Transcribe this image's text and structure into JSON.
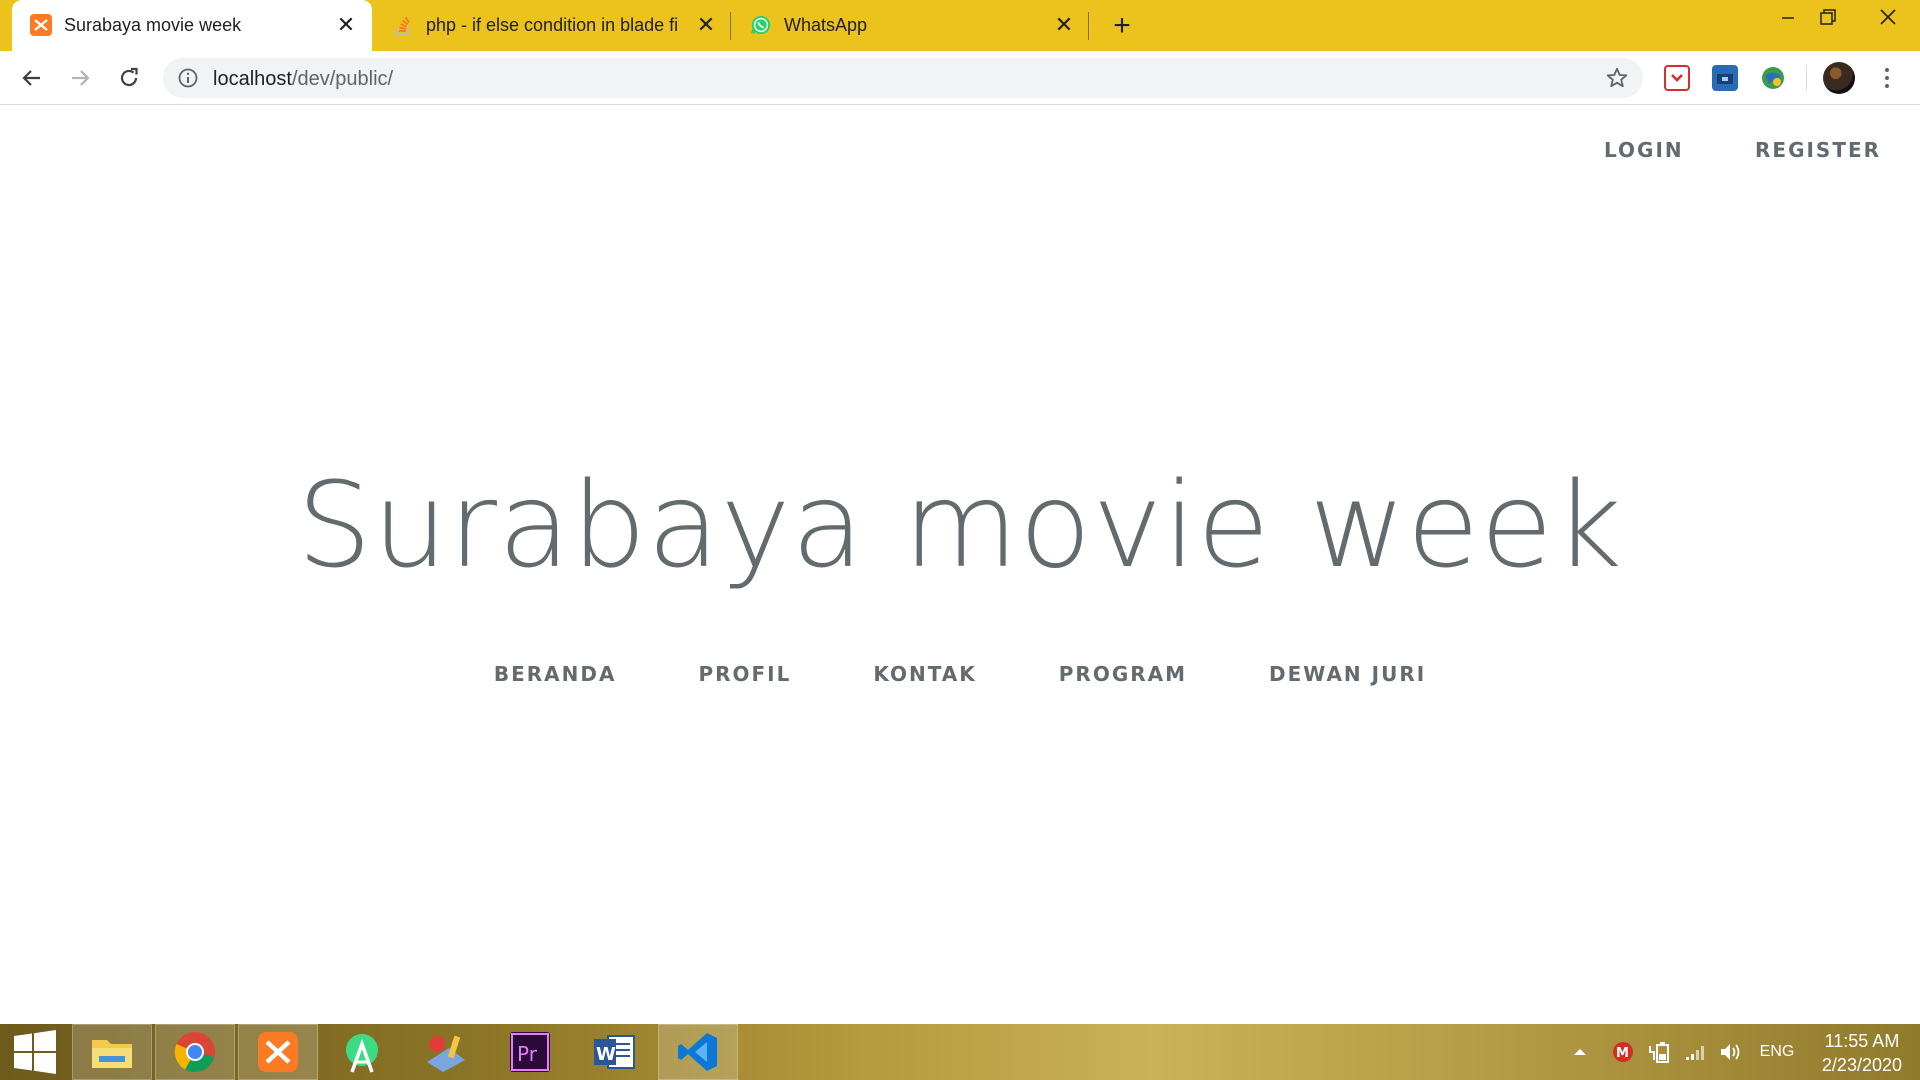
{
  "browser": {
    "tabs": [
      {
        "title": "Surabaya movie week",
        "favicon": "xampp-icon",
        "active": true
      },
      {
        "title": "php - if else condition in blade fi",
        "favicon": "stackoverflow-icon",
        "active": false
      },
      {
        "title": "WhatsApp",
        "favicon": "whatsapp-icon",
        "active": false
      }
    ],
    "new_tab_glyph": "+",
    "address": {
      "host": "localhost",
      "path": "/dev/public/"
    },
    "colors": {
      "tabstrip": "#ecc31c"
    }
  },
  "page": {
    "auth_links": {
      "login": "LOGIN",
      "register": "REGISTER"
    },
    "title": "Surabaya movie week",
    "nav": [
      "BERANDA",
      "PROFIL",
      "KONTAK",
      "PROGRAM",
      "DEWAN JURI"
    ],
    "text_color": "#636b6f"
  },
  "taskbar": {
    "apps": [
      "start-icon",
      "file-explorer-icon",
      "chrome-icon",
      "xampp-icon",
      "android-studio-icon",
      "paint-icon",
      "premiere-icon",
      "word-icon",
      "vscode-icon"
    ],
    "tray": {
      "language": "ENG"
    },
    "clock": {
      "time": "11:55 AM",
      "date": "2/23/2020"
    }
  }
}
